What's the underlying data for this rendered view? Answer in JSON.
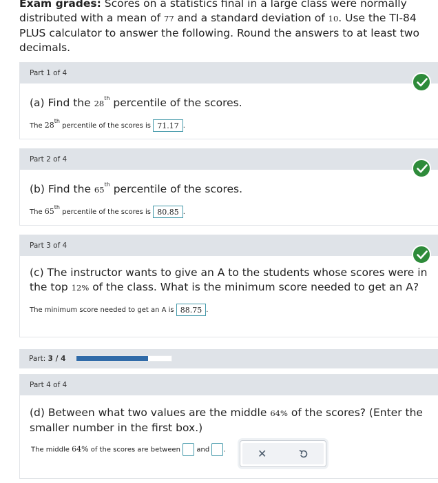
{
  "intro": {
    "bold_label": "Exam grades:",
    "text_1": " Scores on a statistics final in a large class were normally distributed with a mean of ",
    "mean": "77",
    "text_2": " and a standard deviation of ",
    "sd": "10",
    "text_3": ". Use the TI-84 PLUS calculator to answer the following. Round the answers to at least two decimals."
  },
  "parts": [
    {
      "header": "Part 1 of 4",
      "q_prefix": "(a) Find the ",
      "q_num": "28",
      "q_sup": "th",
      "q_suffix": " percentile of the scores.",
      "a_prefix": "The ",
      "a_num": "28",
      "a_sup": "th",
      "a_text": " percentile of the scores is ",
      "answer": "71.17",
      "a_end": "."
    },
    {
      "header": "Part 2 of 4",
      "q_prefix": "(b) Find the ",
      "q_num": "65",
      "q_sup": "th",
      "q_suffix": " percentile of the scores.",
      "a_prefix": "The ",
      "a_num": "65",
      "a_sup": "th",
      "a_text": " percentile of the scores is ",
      "answer": "80.85",
      "a_end": "."
    },
    {
      "header": "Part 3 of 4",
      "q_prefix": "(c) The instructor wants to give an A to the students whose scores were in the top ",
      "q_pct": "12%",
      "q_suffix": " of the class. What is the minimum score needed to get an A?",
      "a_text": "The minimum score needed to get an A is ",
      "answer": "88.75",
      "a_end": "."
    },
    {
      "header": "Part 4 of 4",
      "q_prefix": "(d) Between what two values are the middle ",
      "q_pct": "64%",
      "q_suffix": " of the scores? (Enter the smaller number in the first box.)",
      "a_prefix": "The middle ",
      "a_pct": "64%",
      "a_text": " of the scores are between ",
      "a_and": "and",
      "a_end": "."
    }
  ],
  "progress": {
    "label": "Part:",
    "value": "3 / 4",
    "fraction": 0.75
  },
  "toolbar": {
    "clear_symbol": "✕",
    "undo_icon": "undo-icon"
  },
  "colors": {
    "check_green": "#2e8b3a",
    "progress_blue": "#2f6aa8",
    "header_gray": "#dfe3e8"
  }
}
